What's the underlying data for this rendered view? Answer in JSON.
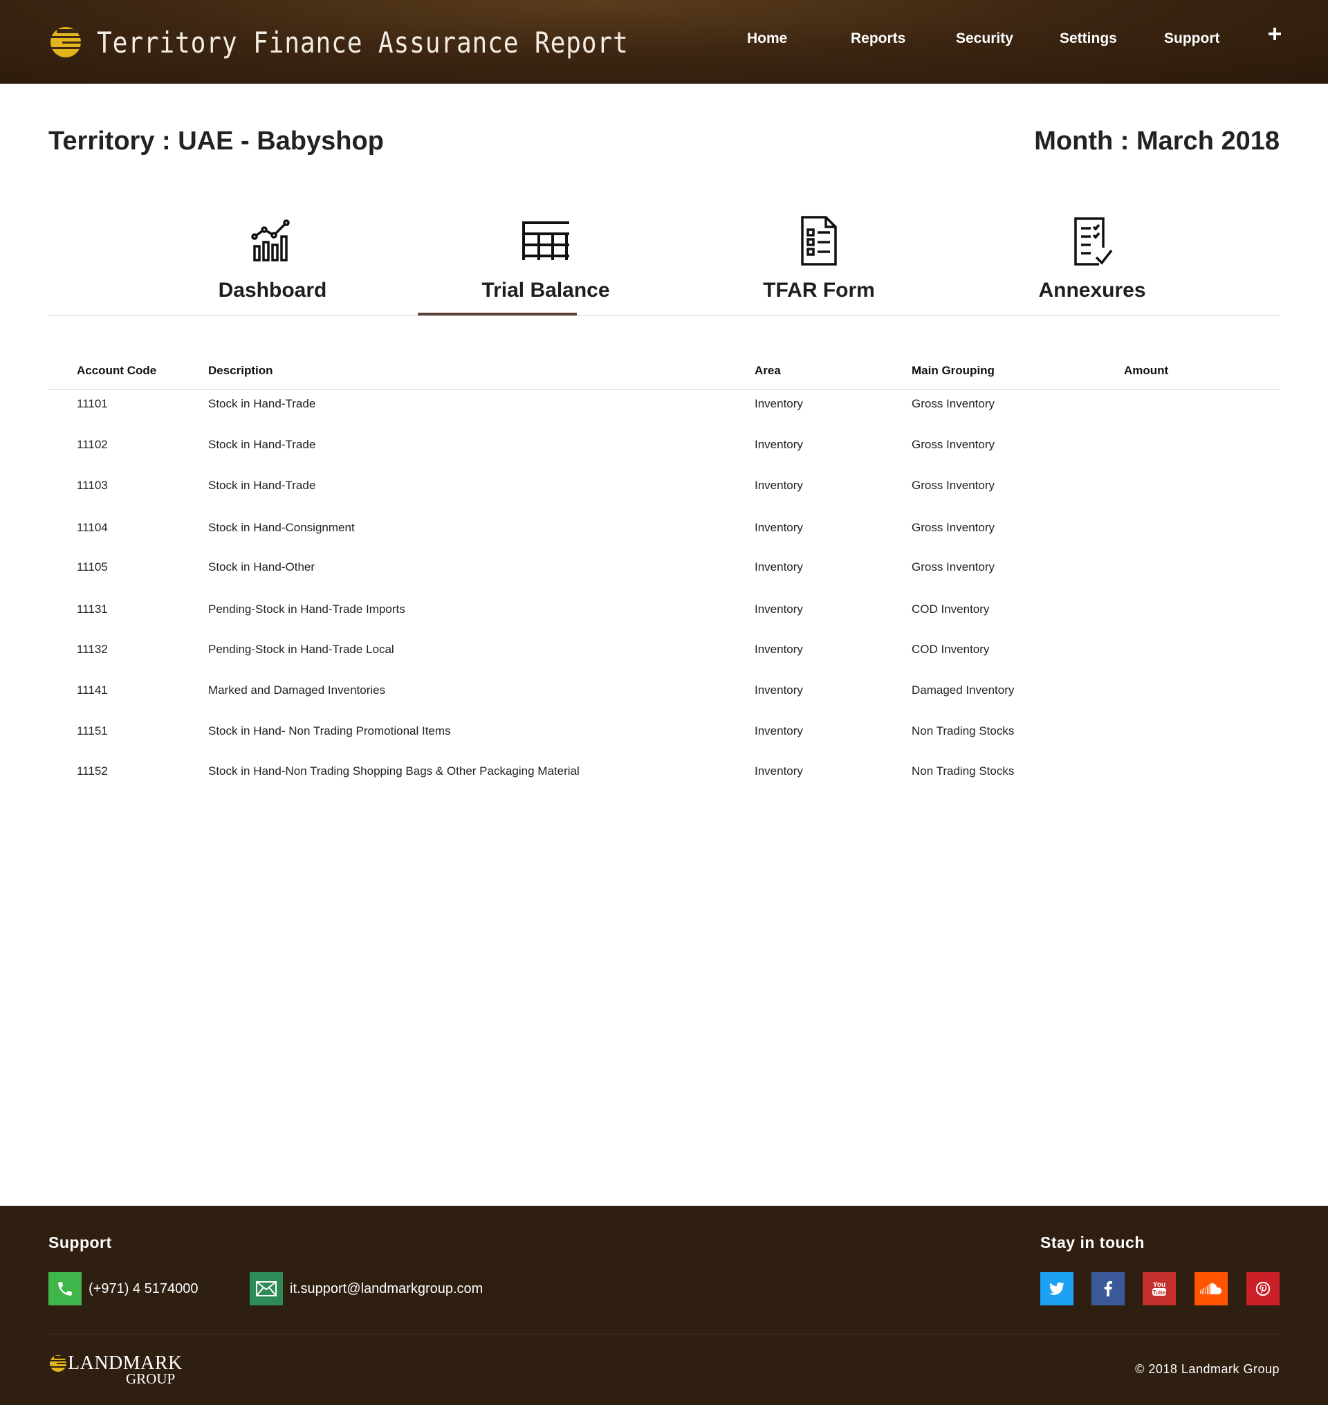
{
  "header": {
    "title": "Territory Finance Assurance Report",
    "nav": [
      "Home",
      "Reports",
      "Security",
      "Settings",
      "Support"
    ],
    "plus_icon": "plus-icon"
  },
  "page": {
    "territory": "Territory : UAE - Babyshop",
    "month": "Month : March 2018"
  },
  "tabs": [
    {
      "label": "Dashboard",
      "icon": "chart-growth-icon"
    },
    {
      "label": "Trial Balance",
      "icon": "table-grid-icon",
      "active": true
    },
    {
      "label": "TFAR Form",
      "icon": "form-document-icon"
    },
    {
      "label": "Annexures",
      "icon": "checklist-icon"
    }
  ],
  "table": {
    "columns": [
      "Account Code",
      "Description",
      "Area",
      "Main Grouping",
      "Amount"
    ],
    "rows": [
      {
        "code": "11101",
        "description": "Stock in Hand-Trade",
        "area": "Inventory",
        "group": "Gross Inventory",
        "amount": ""
      },
      {
        "code": "11102",
        "description": "Stock in Hand-Trade",
        "area": "Inventory",
        "group": "Gross Inventory",
        "amount": ""
      },
      {
        "code": "11103",
        "description": "Stock in Hand-Trade",
        "area": "Inventory",
        "group": "Gross Inventory",
        "amount": ""
      },
      {
        "code": "11104",
        "description": "Stock in Hand-Consignment",
        "area": "Inventory",
        "group": "Gross Inventory",
        "amount": ""
      },
      {
        "code": "11105",
        "description": "Stock in Hand-Other",
        "area": "Inventory",
        "group": "Gross Inventory",
        "amount": ""
      },
      {
        "code": "11131",
        "description": "Pending-Stock in Hand-Trade Imports",
        "area": "Inventory",
        "group": "COD Inventory",
        "amount": ""
      },
      {
        "code": "11132",
        "description": "Pending-Stock in Hand-Trade Local",
        "area": "Inventory",
        "group": "COD Inventory",
        "amount": ""
      },
      {
        "code": "11141",
        "description": "Marked and Damaged Inventories",
        "area": "Inventory",
        "group": "Damaged Inventory",
        "amount": ""
      },
      {
        "code": "11151",
        "description": "Stock in Hand- Non Trading Promotional Items",
        "area": "Inventory",
        "group": "Non Trading Stocks",
        "amount": ""
      },
      {
        "code": "11152",
        "description": "Stock in Hand-Non Trading Shopping Bags & Other Packaging Material",
        "area": "Inventory",
        "group": "Non Trading Stocks",
        "amount": ""
      }
    ]
  },
  "footer": {
    "support_title": "Support",
    "phone": "(+971) 4 5174000",
    "email": "it.support@landmarkgroup.com",
    "stay_title": "Stay in touch",
    "social": [
      {
        "name": "twitter-icon",
        "color": "#1da1f2"
      },
      {
        "name": "facebook-icon",
        "color": "#3b5998"
      },
      {
        "name": "youtube-icon",
        "color": "#c4302b"
      },
      {
        "name": "soundcloud-icon",
        "color": "#ff5500"
      },
      {
        "name": "pinterest-icon",
        "color": "#cb2027"
      }
    ],
    "logo_name": "LANDMARK",
    "logo_sub": "GROUP",
    "copyright": "© 2018 Landmark Group"
  },
  "colors": {
    "header_bg": "#3d2612",
    "footer_bg": "#2e1f10",
    "accent_gold": "#e3b41c",
    "active_tab_underline": "#5a4333",
    "phone_green": "#3fb649",
    "email_green": "#2e8b57"
  }
}
